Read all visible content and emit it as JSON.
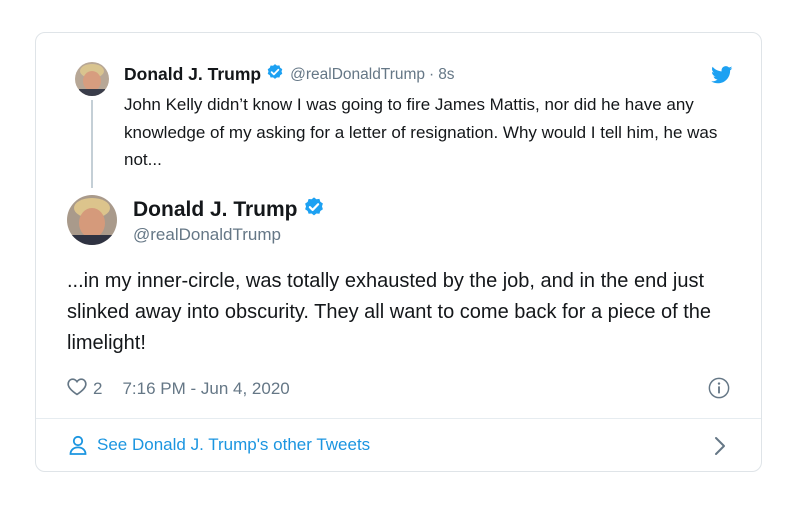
{
  "parent_tweet": {
    "name": "Donald J. Trump",
    "handle": "@realDonaldTrump",
    "separator": "·",
    "time": "8s",
    "text": "John Kelly didn’t know I was going to fire James Mattis, nor did he have any knowledge of my asking for a letter of resignation. Why would I tell him, he was not..."
  },
  "main_tweet": {
    "name": "Donald J. Trump",
    "handle": "@realDonaldTrump",
    "text": "...in my inner-circle, was totally exhausted by the job, and in the end just slinked away into obscurity. They all want to come back for a piece of the limelight!",
    "like_count": "2",
    "timestamp": "7:16 PM - Jun 4, 2020"
  },
  "footer": {
    "label": "See Donald J. Trump's other Tweets"
  },
  "icons": {
    "verified": "verified-badge-icon",
    "bird": "twitter-bird-icon",
    "heart": "heart-outline-icon",
    "info": "info-circle-icon",
    "person": "person-outline-icon",
    "chevron": "chevron-right-icon"
  },
  "colors": {
    "accent": "#1da1f2",
    "link": "#1b95e0",
    "muted": "#657786",
    "text": "#14171a",
    "border": "#dfe4e8"
  }
}
